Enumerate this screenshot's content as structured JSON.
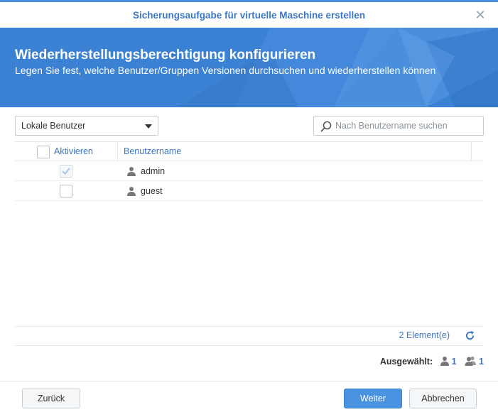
{
  "window": {
    "title": "Sicherungsaufgabe für virtuelle Maschine erstellen"
  },
  "banner": {
    "heading": "Wiederherstellungsberechtigung konfigurieren",
    "description": "Legen Sie fest, welche Benutzer/Gruppen Versionen durchsuchen und wiederherstellen können"
  },
  "filter": {
    "selected": "Lokale Benutzer"
  },
  "search": {
    "placeholder": "Nach Benutzername suchen",
    "value": ""
  },
  "table": {
    "columns": [
      "Aktivieren",
      "Benutzername"
    ],
    "rows": [
      {
        "name": "admin",
        "enabled": true,
        "disabled_state": true
      },
      {
        "name": "guest",
        "enabled": false,
        "disabled_state": false
      }
    ]
  },
  "footer": {
    "count_label": "2 Element(e)",
    "selected_label": "Ausgewählt:",
    "selected_users": "1",
    "selected_groups": "1"
  },
  "buttons": {
    "back": "Zurück",
    "next": "Weiter",
    "cancel": "Abbrechen"
  },
  "colors": {
    "accent": "#3d77c2",
    "banner": "#3b82d4",
    "primary_button": "#4a93e0"
  },
  "icons": {
    "close": "close-icon",
    "search": "search-icon",
    "user": "user-icon",
    "group": "group-icon",
    "refresh": "refresh-icon",
    "dropdown": "chevron-down-icon"
  }
}
